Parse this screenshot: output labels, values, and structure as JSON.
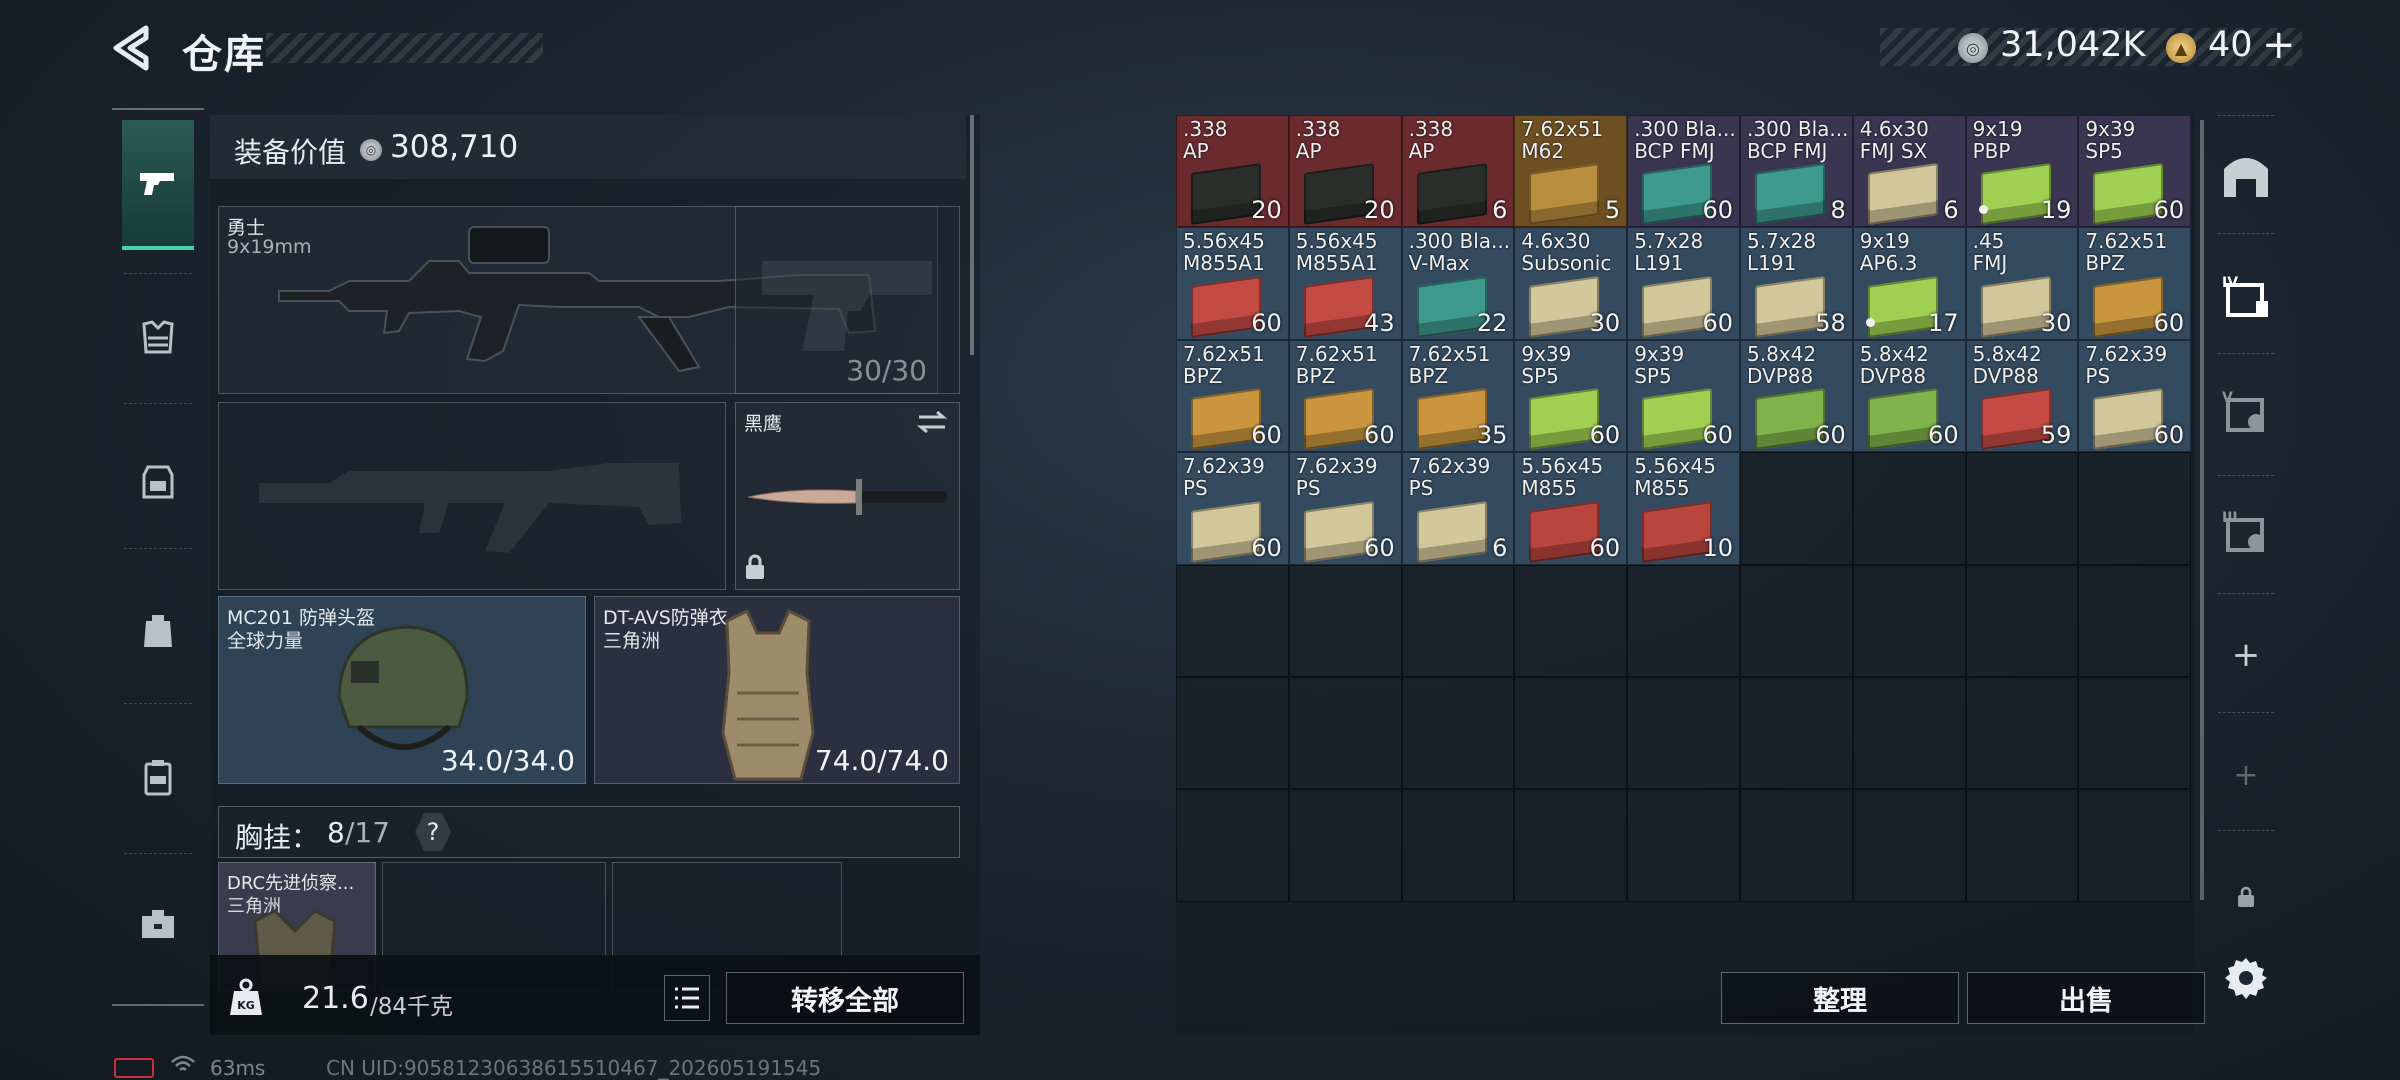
{
  "header": {
    "title": "仓库",
    "currency1": "31,042K",
    "currency2": "40",
    "plus": "+"
  },
  "nav": {
    "items": [
      "weapons",
      "rig",
      "backpack-case",
      "backpack",
      "container",
      "toolbox"
    ]
  },
  "equipment": {
    "value_label": "装备价值",
    "value": "308,710",
    "primary": {
      "name": "勇士",
      "sub": "9x19mm",
      "ammo": "30/30"
    },
    "melee": {
      "name": "黑鹰"
    },
    "helmet": {
      "name": "MC201 防弹头盔",
      "sub": "全球力量",
      "durability": "34.0/34.0"
    },
    "armor": {
      "name": "DT-AVS防弹衣",
      "sub": "三角洲",
      "durability": "74.0/74.0"
    },
    "chest": {
      "label": "胸挂：",
      "current": "8",
      "max": "/17",
      "help": "?"
    },
    "chest_item": {
      "name": "DRC先进侦察...",
      "sub": "三角洲"
    },
    "weight": {
      "current": "21.6",
      "max": "/84千克",
      "icon_label": "KG"
    },
    "transfer_all": "转移全部"
  },
  "stash": {
    "items": [
      {
        "r": 0,
        "c": 0,
        "name": ".338\nAP",
        "qty": "20",
        "bg": "#6a2a2e",
        "box": "#2a2e2a"
      },
      {
        "r": 0,
        "c": 1,
        "name": ".338\nAP",
        "qty": "20",
        "bg": "#6a2a2e",
        "box": "#2a2e2a"
      },
      {
        "r": 0,
        "c": 2,
        "name": ".338\nAP",
        "qty": "6",
        "bg": "#6a2a2e",
        "box": "#2a2e2a"
      },
      {
        "r": 0,
        "c": 3,
        "name": "7.62x51\nM62",
        "qty": "5",
        "bg": "#6e4f22",
        "box": "#b88d3e"
      },
      {
        "r": 0,
        "c": 4,
        "name": ".300 Bla...\nBCP FMJ",
        "qty": "60",
        "bg": "#3a3550",
        "box": "#3e9a8c"
      },
      {
        "r": 0,
        "c": 5,
        "name": ".300 Bla...\nBCP FMJ",
        "qty": "8",
        "bg": "#3a3550",
        "box": "#3e9a8c"
      },
      {
        "r": 0,
        "c": 6,
        "name": "4.6x30\nFMJ SX",
        "qty": "6",
        "bg": "#3a3550",
        "box": "#d2c79a"
      },
      {
        "r": 0,
        "c": 7,
        "name": "9x19\nPBP",
        "qty": "19",
        "bg": "#3a3550",
        "box": "#9fd052",
        "dot": true
      },
      {
        "r": 0,
        "c": 8,
        "name": "9x39\nSP5",
        "qty": "60",
        "bg": "#3a3550",
        "box": "#9fd052"
      },
      {
        "r": 1,
        "c": 0,
        "name": "5.56x45\nM855A1",
        "qty": "60",
        "bg": "#344a5e",
        "box": "#c44a44"
      },
      {
        "r": 1,
        "c": 1,
        "name": "5.56x45\nM855A1",
        "qty": "43",
        "bg": "#344a5e",
        "box": "#c44a44"
      },
      {
        "r": 1,
        "c": 2,
        "name": ".300 Bla...\nV-Max",
        "qty": "22",
        "bg": "#344a5e",
        "box": "#3e9a8c"
      },
      {
        "r": 1,
        "c": 3,
        "name": "4.6x30\nSubsonic",
        "qty": "30",
        "bg": "#344a5e",
        "box": "#d2c79a"
      },
      {
        "r": 1,
        "c": 4,
        "name": "5.7x28\nL191",
        "qty": "60",
        "bg": "#344a5e",
        "box": "#d2c79a"
      },
      {
        "r": 1,
        "c": 5,
        "name": "5.7x28\nL191",
        "qty": "58",
        "bg": "#344a5e",
        "box": "#d2c79a"
      },
      {
        "r": 1,
        "c": 6,
        "name": "9x19\nAP6.3",
        "qty": "17",
        "bg": "#344a5e",
        "box": "#9fd052",
        "dot": true
      },
      {
        "r": 1,
        "c": 7,
        "name": ".45\nFMJ",
        "qty": "30",
        "bg": "#344a5e",
        "box": "#d2c79a"
      },
      {
        "r": 1,
        "c": 8,
        "name": "7.62x51\nBPZ",
        "qty": "60",
        "bg": "#344a5e",
        "box": "#c9963f"
      },
      {
        "r": 2,
        "c": 0,
        "name": "7.62x51\nBPZ",
        "qty": "60",
        "bg": "#344a5e",
        "box": "#c9963f"
      },
      {
        "r": 2,
        "c": 1,
        "name": "7.62x51\nBPZ",
        "qty": "60",
        "bg": "#344a5e",
        "box": "#c9963f"
      },
      {
        "r": 2,
        "c": 2,
        "name": "7.62x51\nBPZ",
        "qty": "35",
        "bg": "#344a5e",
        "box": "#c9963f"
      },
      {
        "r": 2,
        "c": 3,
        "name": "9x39\nSP5",
        "qty": "60",
        "bg": "#344a5e",
        "box": "#9fd052"
      },
      {
        "r": 2,
        "c": 4,
        "name": "9x39\nSP5",
        "qty": "60",
        "bg": "#344a5e",
        "box": "#9fd052"
      },
      {
        "r": 2,
        "c": 5,
        "name": "5.8x42\nDVP88",
        "qty": "60",
        "bg": "#344a5e",
        "box": "#7fb24a"
      },
      {
        "r": 2,
        "c": 6,
        "name": "5.8x42\nDVP88",
        "qty": "60",
        "bg": "#344a5e",
        "box": "#7fb24a"
      },
      {
        "r": 2,
        "c": 7,
        "name": "5.8x42\nDVP88",
        "qty": "59",
        "bg": "#344a5e",
        "box": "#c44a44"
      },
      {
        "r": 2,
        "c": 8,
        "name": "7.62x39\nPS",
        "qty": "60",
        "bg": "#344a5e",
        "box": "#d2c79a"
      },
      {
        "r": 3,
        "c": 0,
        "name": "7.62x39\nPS",
        "qty": "60",
        "bg": "#344a5e",
        "box": "#d2c79a"
      },
      {
        "r": 3,
        "c": 1,
        "name": "7.62x39\nPS",
        "qty": "60",
        "bg": "#344a5e",
        "box": "#d2c79a"
      },
      {
        "r": 3,
        "c": 2,
        "name": "7.62x39\nPS",
        "qty": "6",
        "bg": "#344a5e",
        "box": "#d2c79a"
      },
      {
        "r": 3,
        "c": 3,
        "name": "5.56x45\nM855",
        "qty": "60",
        "bg": "#344a5e",
        "box": "#b8453e"
      },
      {
        "r": 3,
        "c": 4,
        "name": "5.56x45\nM855",
        "qty": "10",
        "bg": "#344a5e",
        "box": "#b8453e"
      }
    ],
    "rows": 7,
    "cols": 9,
    "sort_label": "整理",
    "sell_label": "出售"
  },
  "status": {
    "ping": "63ms",
    "uid": "CN UID:9058123063861551046​7_202605191545"
  },
  "rail": {
    "items": [
      "home",
      "storage-1",
      "storage-5",
      "storage-3",
      "add",
      "add-dim",
      "lock",
      "settings"
    ]
  }
}
